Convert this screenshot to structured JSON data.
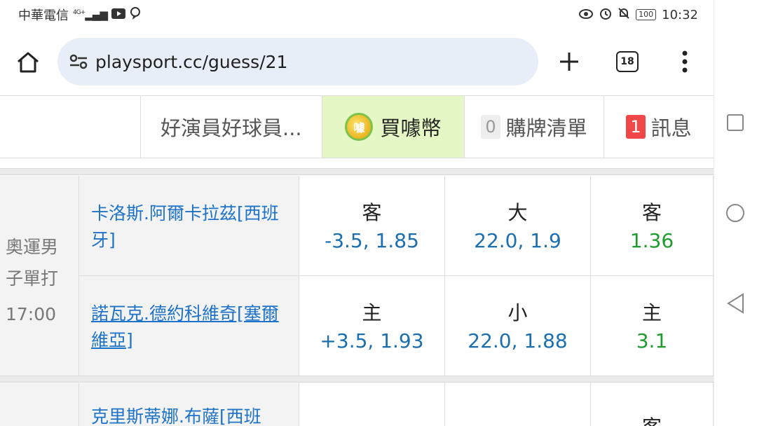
{
  "status_bar": {
    "carrier": "中華電信",
    "network": "4G+",
    "time": "10:32",
    "battery": "100"
  },
  "browser": {
    "url": "playsport.cc/guess/21",
    "tab_count": "18"
  },
  "site_tabs": {
    "tab1": "好演員好球員...",
    "tab2_coin": "噱",
    "tab2": "買噱幣",
    "tab3_count": "0",
    "tab3": "購牌清單",
    "tab4_count": "1",
    "tab4": "訊息"
  },
  "match1": {
    "event_line1": "奧運男",
    "event_line2": "子單打",
    "event_time": "17:00",
    "away_player": "卡洛斯.阿爾卡拉茲[西班牙]",
    "home_player": "諾瓦克.德約科維奇[塞爾維亞]",
    "away_spread_label": "客",
    "away_spread": "-3.5, 1.85",
    "away_total_label": "大",
    "away_total": "22.0, 1.9",
    "away_ml_label": "客",
    "away_ml": "1.36",
    "home_spread_label": "主",
    "home_spread": "+3.5, 1.93",
    "home_total_label": "小",
    "home_total": "22.0, 1.88",
    "home_ml_label": "主",
    "home_ml": "3.1"
  },
  "match2": {
    "away_player": "克里斯蒂娜.布薩[西班",
    "away_ml_label": "客"
  }
}
